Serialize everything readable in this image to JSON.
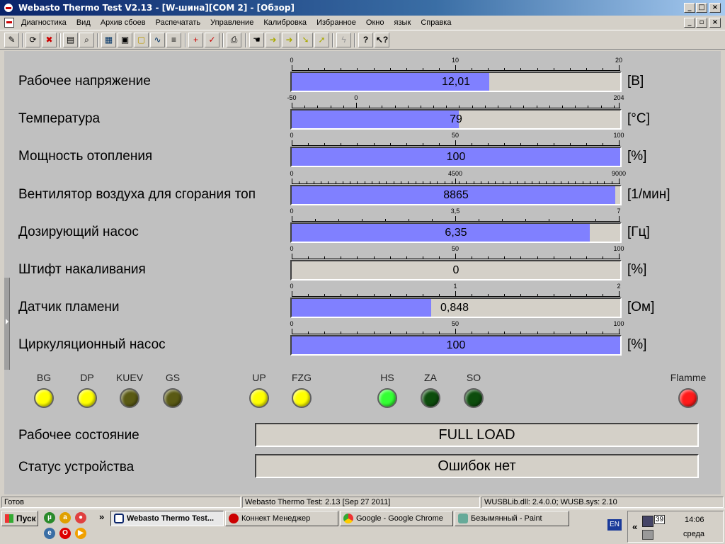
{
  "window": {
    "title": "Webasto Thermo Test V2.13 - [W-шина][COM 2] - [Обзор]",
    "controls": [
      "_",
      "□",
      "×"
    ],
    "mdi_controls": [
      "_",
      "▫",
      "×"
    ]
  },
  "menu": [
    "Диагностика",
    "Вид",
    "Архив сбоев",
    "Распечатать",
    "Управление",
    "Калибровка",
    "Избранное",
    "Окно",
    "язык",
    "Справка"
  ],
  "toolbar_icons": [
    "note-icon",
    "refresh-icon",
    "delete-icon",
    "document-icon",
    "search-document-icon",
    "chart-icon",
    "window-icon",
    "yellow-window-icon",
    "graph-icon",
    "list-icon",
    "add-icon",
    "check-icon",
    "print-icon",
    "hand-icon",
    "arrow-icon",
    "arrow-warning-icon",
    "arrow-down-icon",
    "arrow-alt-icon",
    "lightning-icon",
    "help-icon",
    "help-pointer-icon"
  ],
  "measurements": [
    {
      "label": "Рабочее напряжение",
      "unit": "[В]",
      "value": "12,01",
      "numeric": 12.01,
      "min": 0,
      "max": 20,
      "ticks": [
        "0",
        "10",
        "20"
      ],
      "tick_vals": [
        0,
        10,
        20
      ],
      "minor_step": 1,
      "value_align": "center"
    },
    {
      "label": "Температура",
      "unit": "[°C]",
      "value": "79",
      "numeric": 79,
      "min": -50,
      "max": 204,
      "ticks": [
        "-50",
        "0",
        "204"
      ],
      "tick_vals": [
        -50,
        0,
        204
      ],
      "minor_step": 10,
      "value_align": "center"
    },
    {
      "label": "Мощность отопления",
      "unit": "[%]",
      "value": "100",
      "numeric": 100,
      "min": 0,
      "max": 100,
      "ticks": [
        "0",
        "50",
        "100"
      ],
      "tick_vals": [
        0,
        50,
        100
      ],
      "minor_step": 5,
      "value_align": "center"
    },
    {
      "label": "Вентилятор воздуха для сгорания топ",
      "unit": "[1/мин]",
      "value": "8865",
      "numeric": 8865,
      "min": 0,
      "max": 9000,
      "ticks": [
        "0",
        "4500",
        "9000"
      ],
      "tick_vals": [
        0,
        4500,
        9000
      ],
      "minor_step": 200,
      "value_align": "center"
    },
    {
      "label": "Дозирующий насос",
      "unit": "[Гц]",
      "value": "6,35",
      "numeric": 6.35,
      "min": 0,
      "max": 7,
      "ticks": [
        "0",
        "3,5",
        "7"
      ],
      "tick_vals": [
        0,
        3.5,
        7
      ],
      "minor_step": 0.5,
      "value_align": "center"
    },
    {
      "label": "Штифт накаливания",
      "unit": "[%]",
      "value": "0",
      "numeric": 0,
      "min": 0,
      "max": 100,
      "ticks": [
        "0",
        "50",
        "100"
      ],
      "tick_vals": [
        0,
        50,
        100
      ],
      "minor_step": 5,
      "value_align": "center"
    },
    {
      "label": "Датчик пламени",
      "unit": "[Ом]",
      "value": "0,848",
      "numeric": 0.848,
      "min": 0,
      "max": 2,
      "ticks": [
        "0",
        "1",
        "2"
      ],
      "tick_vals": [
        0,
        1,
        2
      ],
      "minor_step": 0.1,
      "value_align": "left"
    },
    {
      "label": "Циркуляционный насос",
      "unit": "[%]",
      "value": "100",
      "numeric": 100,
      "min": 0,
      "max": 100,
      "ticks": [
        "0",
        "50",
        "100"
      ],
      "tick_vals": [
        0,
        50,
        100
      ],
      "minor_step": 5,
      "value_align": "center"
    }
  ],
  "indicators": [
    {
      "label": "BG",
      "color": "#ffff00"
    },
    {
      "label": "DP",
      "color": "#ffff00"
    },
    {
      "label": "KUEV",
      "color": "#5a5a14"
    },
    {
      "label": "GS",
      "color": "#5a5a14"
    },
    {
      "label": "UP",
      "color": "#ffff00"
    },
    {
      "label": "FZG",
      "color": "#ffff00"
    },
    {
      "label": "HS",
      "color": "#33ff33"
    },
    {
      "label": "ZA",
      "color": "#0d4d0d"
    },
    {
      "label": "SO",
      "color": "#0d4d0d"
    },
    {
      "label": "Flamme",
      "color": "#ff1a1a"
    }
  ],
  "state": {
    "operating_label": "Рабочее состояние",
    "operating_value": "FULL LOAD",
    "device_label": "Статус устройства",
    "device_value": "Ошибок нет"
  },
  "statusbar": {
    "ready": "Готов",
    "version": "Webasto Thermo Test: 2.13 [Sep 27 2011]",
    "driver": "WUSBLib.dll: 2.4.0.0; WUSB.sys: 2.10"
  },
  "taskbar": {
    "start": "Пуск",
    "chevron": "»",
    "tasks": [
      "Webasto Thermo Test...",
      "Коннект Менеджер",
      "Google - Google Chrome",
      "Безымянный - Paint"
    ],
    "lang": "EN",
    "tray_chevron": "«",
    "tray_number": "39",
    "time": "14:06",
    "day": "среда"
  }
}
